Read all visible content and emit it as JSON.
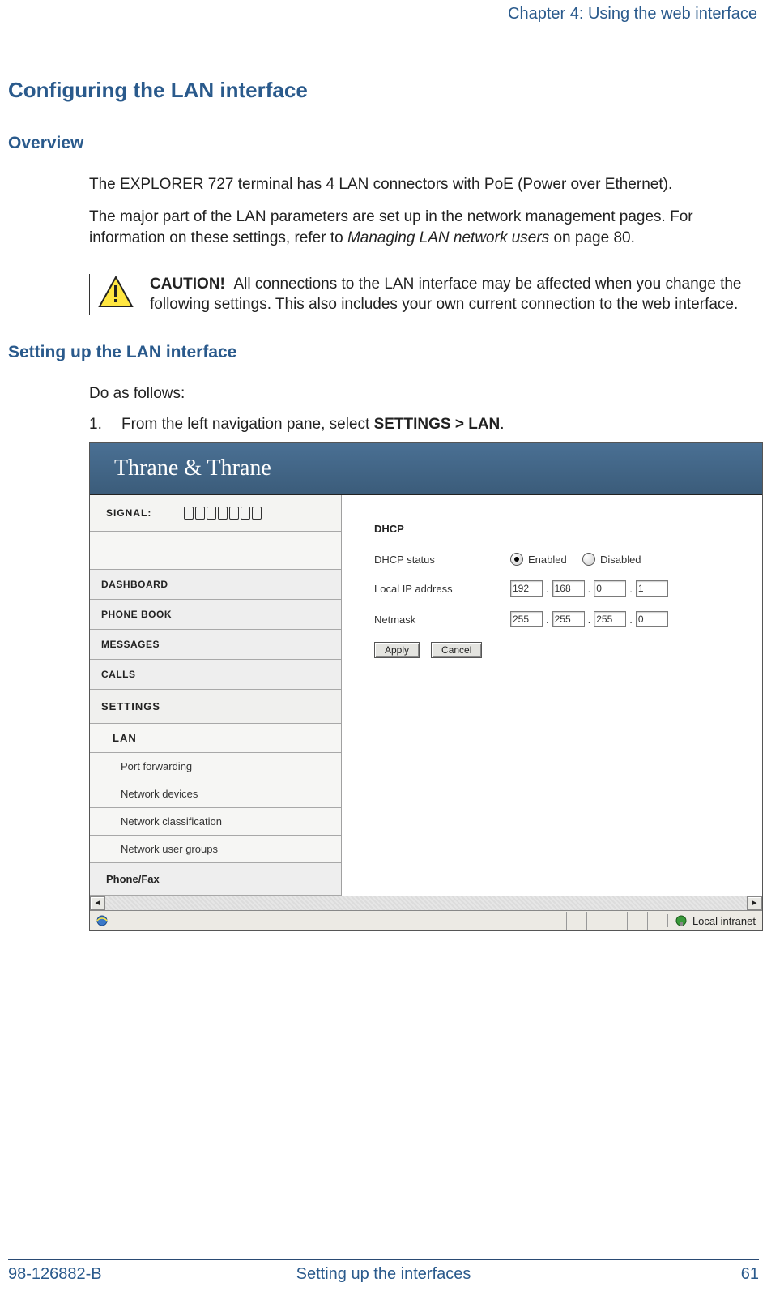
{
  "chapter": "Chapter 4: Using the web interface",
  "section_title": "Configuring the LAN interface",
  "overview_heading": "Overview",
  "overview_p1": "The EXPLORER 727 terminal has 4 LAN connectors with PoE (Power over Ethernet).",
  "overview_p2_pre": "The major part of the LAN parameters are set up in the network management pages. For information on these settings, refer to ",
  "overview_p2_em": "Managing LAN network users",
  "overview_p2_post": " on page 80.",
  "caution_label": "CAUTION!",
  "caution_text": "All connections to the LAN interface may be affected when you change the following settings. This also includes your own current connection to the web interface.",
  "setup_heading": "Setting up the LAN interface",
  "setup_intro": "Do as follows:",
  "step1_num": "1.",
  "step1_pre": "From the left navigation pane, select ",
  "step1_strong": "SETTINGS > LAN",
  "step1_post": ".",
  "shot": {
    "brand": "Thrane & Thrane",
    "signal_label": "SIGNAL:",
    "nav": {
      "dashboard": "DASHBOARD",
      "phonebook": "PHONE BOOK",
      "messages": "MESSAGES",
      "calls": "CALLS",
      "settings": "SETTINGS",
      "lan": "LAN",
      "sub": [
        "Port forwarding",
        "Network devices",
        "Network classification",
        "Network user groups"
      ],
      "phonefax": "Phone/Fax"
    },
    "form": {
      "title": "DHCP",
      "status_label": "DHCP status",
      "enabled": "Enabled",
      "disabled": "Disabled",
      "ip_label": "Local IP address",
      "ip": [
        "192",
        "168",
        "0",
        "1"
      ],
      "netmask_label": "Netmask",
      "netmask": [
        "255",
        "255",
        "255",
        "0"
      ],
      "apply": "Apply",
      "cancel": "Cancel"
    },
    "status_zone": "Local intranet"
  },
  "footer": {
    "left": "98-126882-B",
    "center": "Setting up the interfaces",
    "right": "61"
  }
}
